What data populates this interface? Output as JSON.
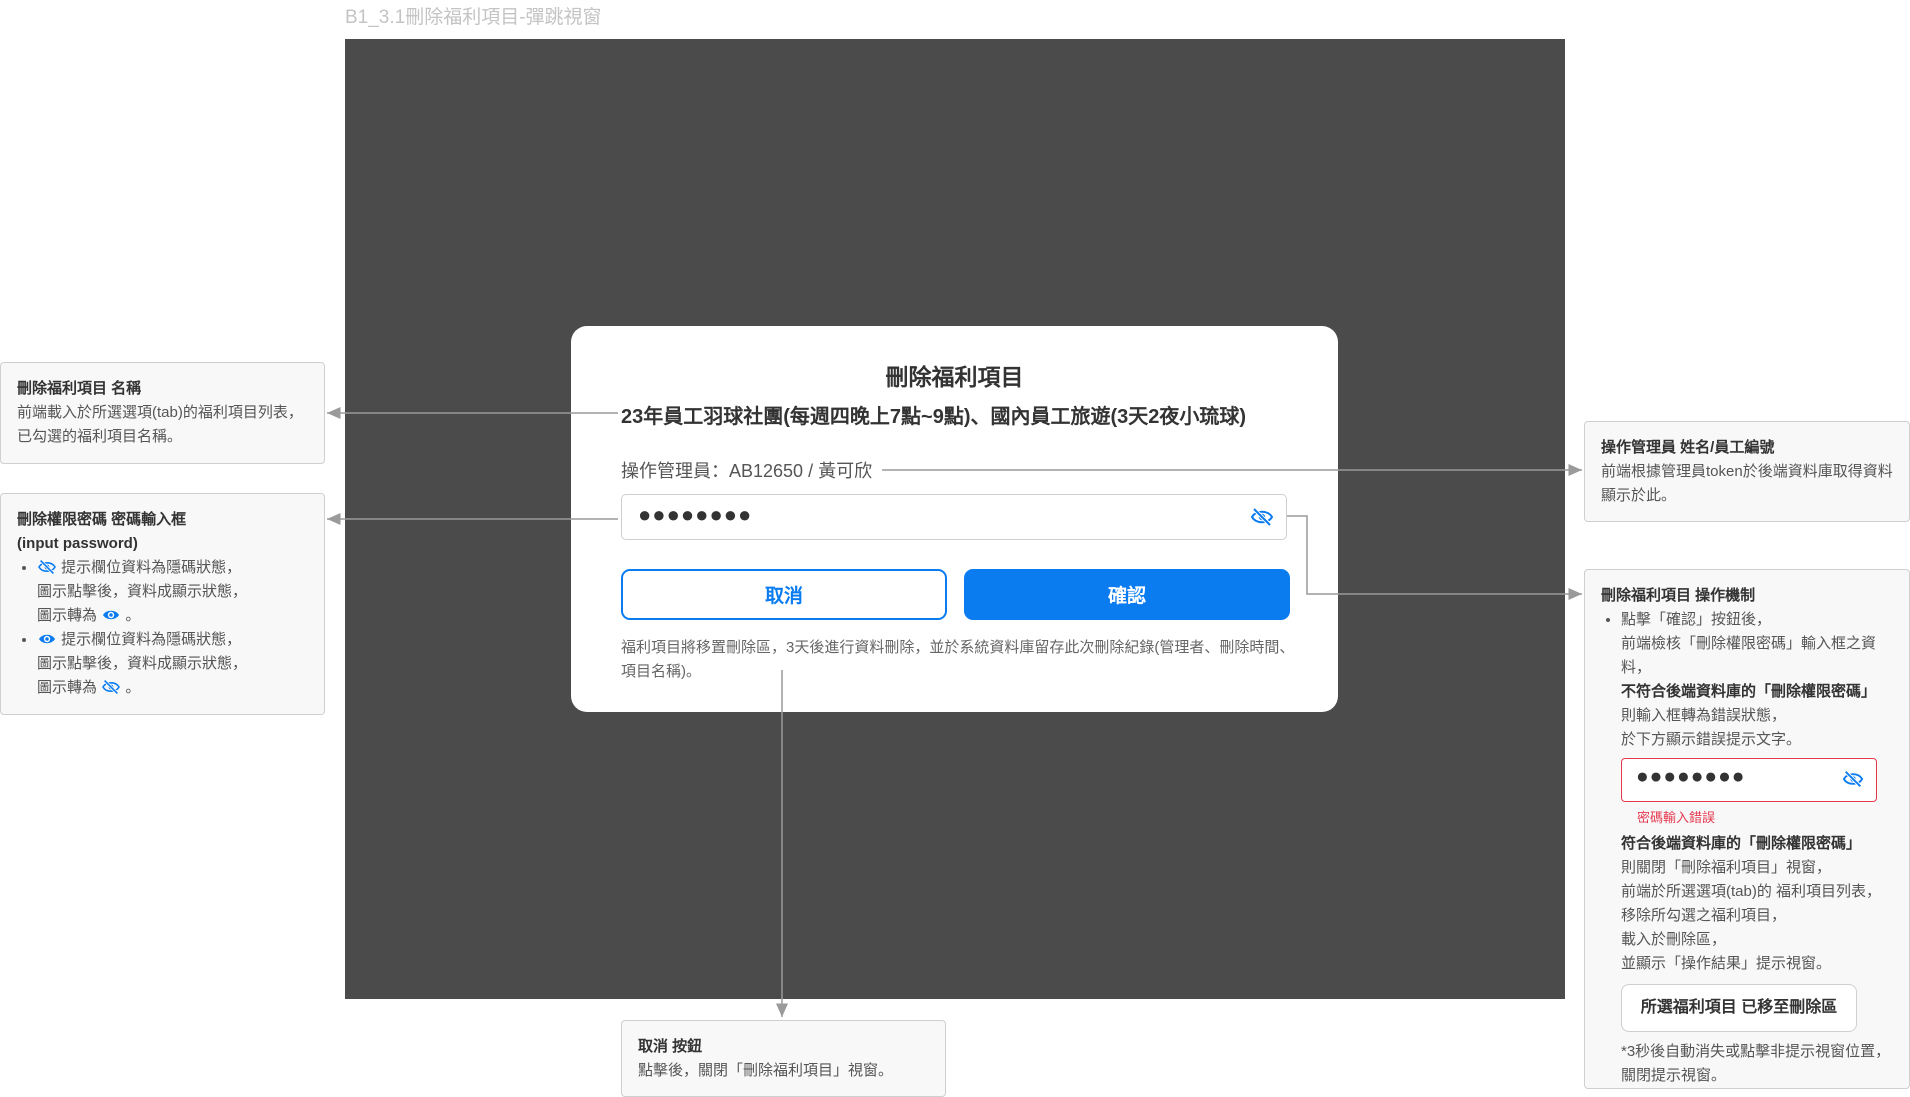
{
  "page_label": "B1_3.1刪除福利項目-彈跳視窗",
  "modal": {
    "title": "刪除福利項目",
    "items_text": "23年員工羽球社團(每週四晚上7點~9點)、國內員工旅遊(3天2夜小琉球)",
    "operator_text": "操作管理員：AB12650 / 黃可欣",
    "password_masked": "●●●●●●●●",
    "cancel_label": "取消",
    "confirm_label": "確認",
    "note_text": "福利項目將移置刪除區，3天後進行資料刪除，並於系統資料庫留存此次刪除紀錄(管理者、刪除時間、項目名稱)。"
  },
  "annotations": {
    "name": {
      "title": "刪除福利項目 名稱",
      "body": "前端載入於所選選項(tab)的福利項目列表，已勾選的福利項目名稱。"
    },
    "password": {
      "title": "刪除權限密碼 密碼輸入框",
      "subtitle": "(input password)",
      "b1_l1": "提示欄位資料為隱碼狀態，",
      "b1_l2": "圖示點擊後，資料成顯示狀態，",
      "b1_l3_pre": "圖示轉為",
      "b2_l1": "提示欄位資料為隱碼狀態，",
      "b2_l2": "圖示點擊後，資料成顯示狀態，",
      "b2_l3_pre": "圖示轉為",
      "period": "。"
    },
    "cancel": {
      "title": "取消 按鈕",
      "body": "點擊後，關閉「刪除福利項目」視窗。"
    },
    "operator": {
      "title": "操作管理員 姓名/員工編號",
      "body": "前端根據管理員token於後端資料庫取得資料顯示於此。"
    },
    "mechanism": {
      "title": "刪除福利項目 操作機制",
      "l1": "點擊「確認」按鈕後，",
      "l2": "前端檢核「刪除權限密碼」輸入框之資料，",
      "l3": "不符合後端資料庫的「刪除權限密碼」",
      "l4": "則輸入框轉為錯誤狀態，",
      "l5": "於下方顯示錯誤提示文字。",
      "err_password": "●●●●●●●●",
      "err_text": "密碼輸入錯誤",
      "l6": "符合後端資料庫的「刪除權限密碼」",
      "l7": "則關閉「刪除福利項目」視窗，",
      "l8": "前端於所選選項(tab)的 福利項目列表，移除所勾選之福利項目，",
      "l9": "載入於刪除區，",
      "l10": "並顯示「操作結果」提示視窗。",
      "toast": "所選福利項目 已移至刪除區",
      "footnote": "*3秒後自動消失或點擊非提示視窗位置，關閉提示視窗。"
    }
  },
  "colors": {
    "overlay": "#4b4b4b",
    "primary": "#0a7cf0",
    "error": "#e53950",
    "icon_blue": "#0a7cf0"
  },
  "icons": [
    "eye-off-icon",
    "eye-icon"
  ]
}
